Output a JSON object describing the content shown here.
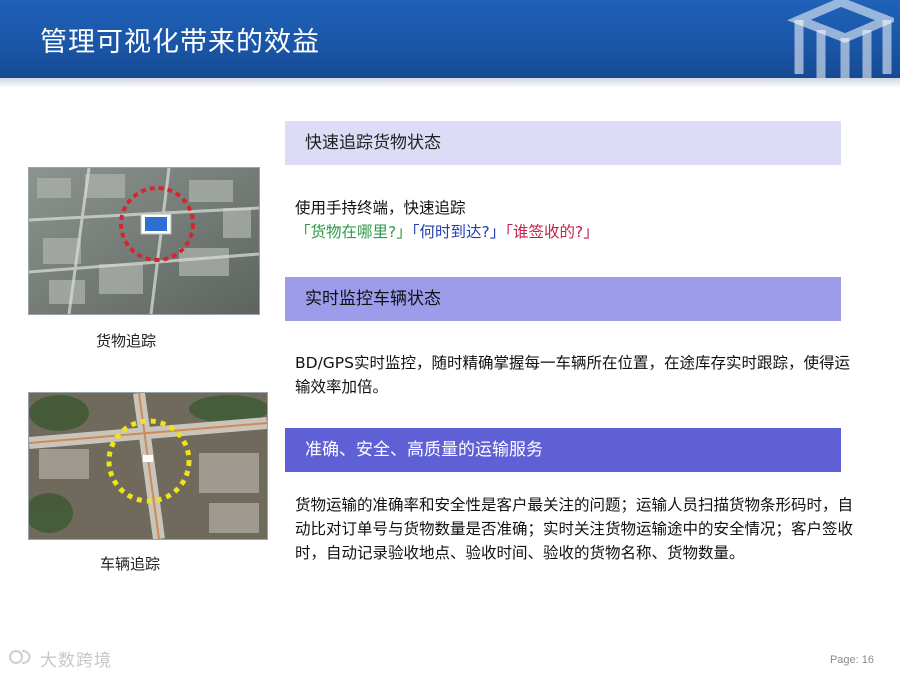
{
  "header": {
    "title": "管理可视化带来的效益"
  },
  "left": {
    "photo1_caption": "货物追踪",
    "photo2_caption": "车辆追踪"
  },
  "sections": [
    {
      "heading": "快速追踪货物状态",
      "line1": "使用手持终端，快速追踪",
      "q1": "「货物在哪里?」",
      "q2": "「何时到达?」",
      "q3": "「谁签收的?」"
    },
    {
      "heading": "实时监控车辆状态",
      "text": "BD/GPS实时监控，随时精确掌握每一车辆所在位置，在途库存实时跟踪，使得运输效率加倍。"
    },
    {
      "heading": "准确、安全、高质量的运输服务",
      "text": "货物运输的准确率和安全性是客户最关注的问题；运输人员扫描货物条形码时，自动比对订单号与货物数量是否准确；实时关注货物运输途中的安全情况；客户签收时，自动记录验收地点、验收时间、验收的货物名称、货物数量。"
    }
  ],
  "footer": {
    "watermark": "大数跨境",
    "page": "Page: 16"
  },
  "colors": {
    "header": "#1a55a6",
    "band1": "#dcdcf7",
    "band2": "#9c9cea",
    "band3": "#5f5fd6",
    "q_green": "#2f9a4a",
    "q_blue": "#1f3fb3",
    "q_red": "#c8204e"
  },
  "icons": {
    "logo": "cube-logo-icon",
    "watermark": "brand-watermark-icon"
  }
}
